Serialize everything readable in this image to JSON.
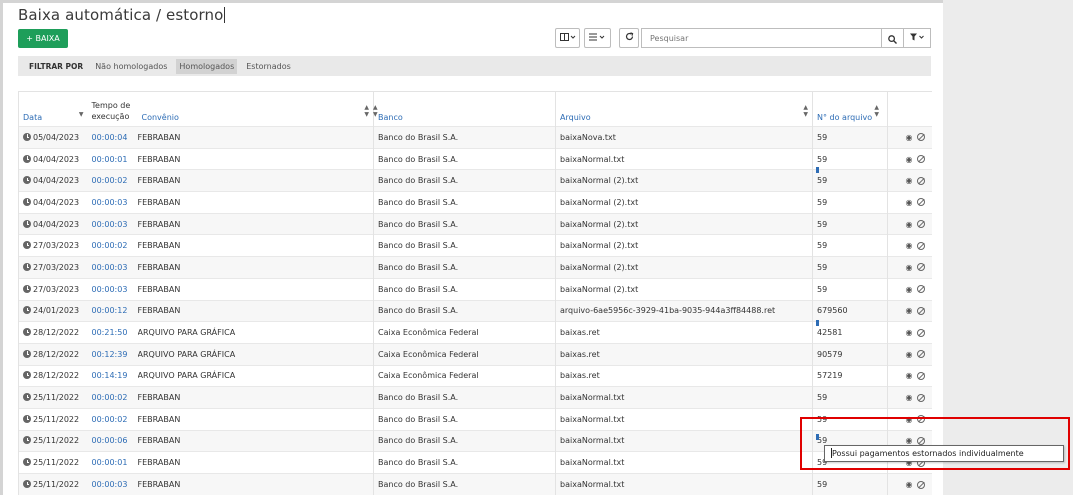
{
  "page": {
    "title": "Baixa automática / estorno",
    "add_button": "+ BAIXA"
  },
  "toolbar": {
    "columns_icon": "columns-icon",
    "list_icon": "list-icon",
    "refresh_icon": "refresh-icon",
    "search_placeholder": "Pesquisar",
    "search_icon": "search-icon",
    "filter_icon": "filter-icon"
  },
  "filterbar": {
    "label": "FILTRAR POR",
    "options": [
      "Não homologados",
      "Homologados",
      "Estornados"
    ],
    "active": "Homologados"
  },
  "table": {
    "headers": {
      "data": "Data",
      "tempo_line1": "Tempo de",
      "tempo_line2": "execução",
      "convenio": "Convênio",
      "banco": "Banco",
      "arquivo": "Arquivo",
      "numero": "N° do arquivo"
    },
    "rows": [
      {
        "data": "05/04/2023",
        "tempo": "00:00:04",
        "convenio": "FEBRABAN",
        "banco": "Banco do Brasil S.A.",
        "arquivo": "baixaNova.txt",
        "numero": "59"
      },
      {
        "data": "04/04/2023",
        "tempo": "00:00:01",
        "convenio": "FEBRABAN",
        "banco": "Banco do Brasil S.A.",
        "arquivo": "baixaNormal.txt",
        "numero": "59"
      },
      {
        "data": "04/04/2023",
        "tempo": "00:00:02",
        "convenio": "FEBRABAN",
        "banco": "Banco do Brasil S.A.",
        "arquivo": "baixaNormal (2).txt",
        "numero": "59"
      },
      {
        "data": "04/04/2023",
        "tempo": "00:00:03",
        "convenio": "FEBRABAN",
        "banco": "Banco do Brasil S.A.",
        "arquivo": "baixaNormal (2).txt",
        "numero": "59"
      },
      {
        "data": "04/04/2023",
        "tempo": "00:00:03",
        "convenio": "FEBRABAN",
        "banco": "Banco do Brasil S.A.",
        "arquivo": "baixaNormal (2).txt",
        "numero": "59"
      },
      {
        "data": "27/03/2023",
        "tempo": "00:00:02",
        "convenio": "FEBRABAN",
        "banco": "Banco do Brasil S.A.",
        "arquivo": "baixaNormal (2).txt",
        "numero": "59"
      },
      {
        "data": "27/03/2023",
        "tempo": "00:00:03",
        "convenio": "FEBRABAN",
        "banco": "Banco do Brasil S.A.",
        "arquivo": "baixaNormal (2).txt",
        "numero": "59"
      },
      {
        "data": "27/03/2023",
        "tempo": "00:00:03",
        "convenio": "FEBRABAN",
        "banco": "Banco do Brasil S.A.",
        "arquivo": "baixaNormal (2).txt",
        "numero": "59"
      },
      {
        "data": "24/01/2023",
        "tempo": "00:00:12",
        "convenio": "FEBRABAN",
        "banco": "Banco do Brasil S.A.",
        "arquivo": "arquivo-6ae5956c-3929-41ba-9035-944a3ff84488.ret",
        "numero": "679560"
      },
      {
        "data": "28/12/2022",
        "tempo": "00:21:50",
        "convenio": "ARQUIVO PARA GRÁFICA",
        "banco": "Caixa Econômica Federal",
        "arquivo": "baixas.ret",
        "numero": "42581"
      },
      {
        "data": "28/12/2022",
        "tempo": "00:12:39",
        "convenio": "ARQUIVO PARA GRÁFICA",
        "banco": "Caixa Econômica Federal",
        "arquivo": "baixas.ret",
        "numero": "90579"
      },
      {
        "data": "28/12/2022",
        "tempo": "00:14:19",
        "convenio": "ARQUIVO PARA GRÁFICA",
        "banco": "Caixa Econômica Federal",
        "arquivo": "baixas.ret",
        "numero": "57219"
      },
      {
        "data": "25/11/2022",
        "tempo": "00:00:02",
        "convenio": "FEBRABAN",
        "banco": "Banco do Brasil S.A.",
        "arquivo": "baixaNormal.txt",
        "numero": "59"
      },
      {
        "data": "25/11/2022",
        "tempo": "00:00:02",
        "convenio": "FEBRABAN",
        "banco": "Banco do Brasil S.A.",
        "arquivo": "baixaNormal.txt",
        "numero": "59"
      },
      {
        "data": "25/11/2022",
        "tempo": "00:00:06",
        "convenio": "FEBRABAN",
        "banco": "Banco do Brasil S.A.",
        "arquivo": "baixaNormal.txt",
        "numero": "59"
      },
      {
        "data": "25/11/2022",
        "tempo": "00:00:01",
        "convenio": "FEBRABAN",
        "banco": "Banco do Brasil S.A.",
        "arquivo": "baixaNormal.txt",
        "numero": "59"
      },
      {
        "data": "25/11/2022",
        "tempo": "00:00:03",
        "convenio": "FEBRABAN",
        "banco": "Banco do Brasil S.A.",
        "arquivo": "baixaNormal.txt",
        "numero": "59"
      }
    ]
  },
  "tooltip": {
    "text": "Possui pagamentos estornados individualmente"
  },
  "colors": {
    "accent": "#2d6cb5",
    "add_button": "#1e9e5a",
    "highlight_box": "#e00000"
  }
}
